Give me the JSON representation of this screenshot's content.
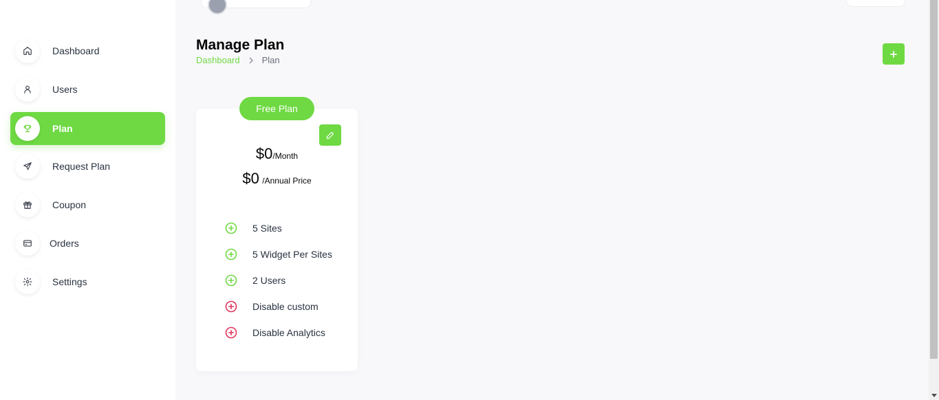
{
  "sidebar": {
    "items": [
      {
        "label": "Dashboard",
        "icon": "home-icon"
      },
      {
        "label": "Users",
        "icon": "user-icon"
      },
      {
        "label": "Plan",
        "icon": "trophy-icon",
        "active": true
      },
      {
        "label": "Request Plan",
        "icon": "send-icon"
      },
      {
        "label": "Coupon",
        "icon": "gift-icon"
      },
      {
        "label": "Orders",
        "icon": "credit-card-icon"
      },
      {
        "label": "Settings",
        "icon": "gear-icon"
      }
    ]
  },
  "header": {
    "title": "Manage Plan",
    "breadcrumb": {
      "home": "Dashboard",
      "current": "Plan"
    },
    "add_icon": "plus-icon"
  },
  "plan": {
    "name": "Free Plan",
    "monthly_price": "$0",
    "monthly_unit": "/Month",
    "annual_price": "$0",
    "annual_unit": "/Annual Price",
    "features": [
      {
        "label": "5 Sites",
        "enabled": true
      },
      {
        "label": "5 Widget Per Sites",
        "enabled": true
      },
      {
        "label": "2 Users",
        "enabled": true
      },
      {
        "label": "Disable custom",
        "enabled": false
      },
      {
        "label": "Disable Analytics",
        "enabled": false
      }
    ]
  },
  "colors": {
    "accent": "#6fd943",
    "enabled": "#6fd943",
    "disabled": "#e2335a",
    "background": "#f8f8fb"
  }
}
